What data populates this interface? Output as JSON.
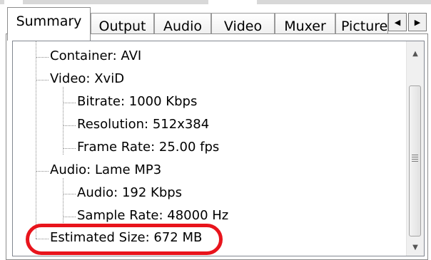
{
  "tabs": [
    {
      "label": "Summary",
      "active": true
    },
    {
      "label": "Output",
      "active": false
    },
    {
      "label": "Audio",
      "active": false
    },
    {
      "label": "Video",
      "active": false
    },
    {
      "label": "Muxer",
      "active": false
    },
    {
      "label": "Picture",
      "active": false
    }
  ],
  "tab_scroll": {
    "left_icon": "triangle-left-icon",
    "right_icon": "triangle-right-icon"
  },
  "tree": {
    "container": "Container: AVI",
    "video": {
      "label": "Video: XviD",
      "children": [
        "Bitrate: 1000 Kbps",
        "Resolution: 512x384",
        "Frame Rate: 25.00 fps"
      ]
    },
    "audio": {
      "label": "Audio: Lame MP3",
      "children": [
        "Audio: 192 Kbps",
        "Sample Rate: 48000 Hz"
      ]
    },
    "estimated_size": "Estimated Size: 672 MB"
  },
  "scrollbar": {
    "up_icon": "scroll-up-arrow-icon",
    "down_icon": "scroll-down-arrow-icon",
    "grip_icon": "scroll-grip-icon"
  },
  "annotation": {
    "shape": "rounded-rectangle",
    "color": "#e8141c",
    "target": "estimated-size"
  }
}
